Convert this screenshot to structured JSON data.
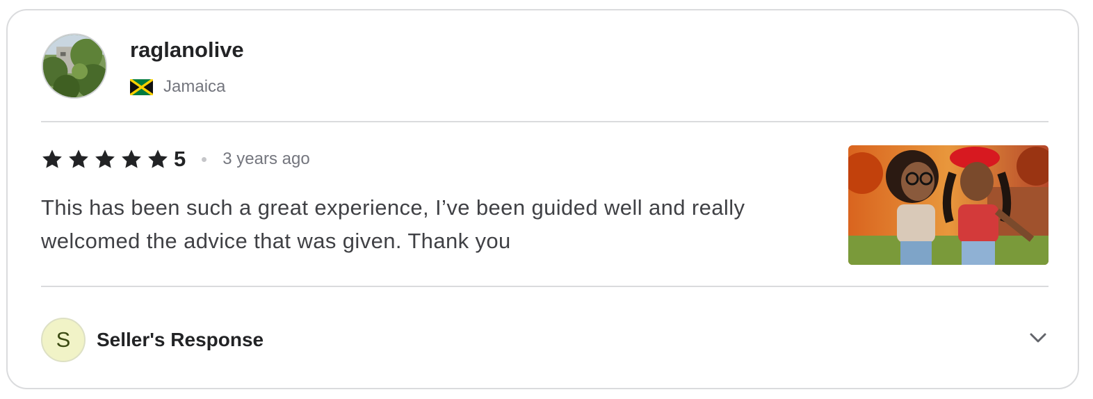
{
  "reviewer": {
    "username": "raglanolive",
    "country": "Jamaica",
    "avatar_icon": "profile-photo",
    "flag_icon": "jamaica-flag-icon"
  },
  "review": {
    "rating": 5,
    "rating_label": "5",
    "time_ago": "3 years ago",
    "text": "This has been such a great experience, I’ve been guided well and really welcomed the advice that was given. Thank you",
    "star_icon": "star-icon",
    "star_color": "#222325"
  },
  "seller_response": {
    "avatar_letter": "S",
    "label": "Seller's Response",
    "expand_icon": "chevron-down-icon",
    "avatar_bg": "#f1f3c7"
  }
}
